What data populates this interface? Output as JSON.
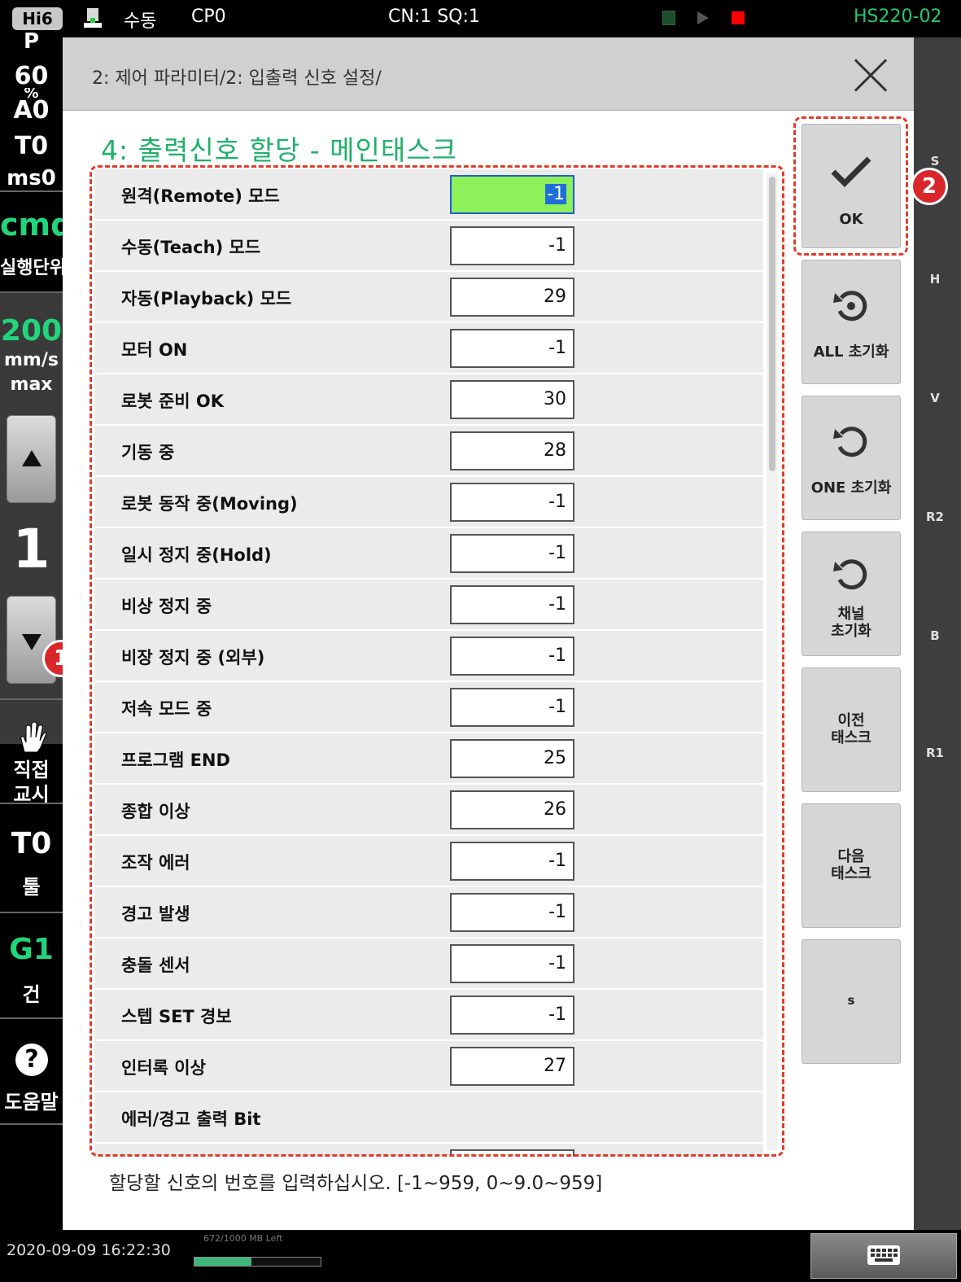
{
  "topbar": {
    "logo": "Hi6",
    "mode": "수동",
    "program": "CP0",
    "cn_sq": "CN:1 SQ:1",
    "model": "HS220-02"
  },
  "left": {
    "p": "P",
    "speed_pct": "60",
    "pct": "%",
    "a0": "A0",
    "t0": "T0",
    "ms": "ms0",
    "cmd": "cmd",
    "exec_unit": "실행단위",
    "speed": "200",
    "speed_unit": "mm/s",
    "speed_max": "max",
    "step": "1",
    "badge1": "1",
    "direct": "직접",
    "teach": "교시",
    "tool_no": "T0",
    "tool": "툴",
    "gun_no": "G1",
    "gun": "건",
    "help": "도움말",
    "help_glyph": "?"
  },
  "right_strip": [
    "S",
    "H",
    "V",
    "R2",
    "B",
    "R1"
  ],
  "dialog": {
    "breadcrumb": "2: 제어 파라미터/2: 입출력 신호 설정/",
    "title": "4: 출력신호 할당 - 메인태스크",
    "hint": "할당할 신호의 번호를 입력하십시오. [-1~959, 0~9.0~959]",
    "rows": [
      {
        "label": "원격(Remote) 모드",
        "value": "-1"
      },
      {
        "label": "수동(Teach) 모드",
        "value": "-1"
      },
      {
        "label": "자동(Playback) 모드",
        "value": "29"
      },
      {
        "label": "모터 ON",
        "value": "-1"
      },
      {
        "label": "로봇 준비 OK",
        "value": "30"
      },
      {
        "label": "기동 중",
        "value": "28"
      },
      {
        "label": "로봇 동작 중(Moving)",
        "value": "-1"
      },
      {
        "label": "일시 정지 중(Hold)",
        "value": "-1"
      },
      {
        "label": "비상 정지 중",
        "value": "-1"
      },
      {
        "label": "비장 정지 중 (외부)",
        "value": "-1"
      },
      {
        "label": "저속 모드 중",
        "value": "-1"
      },
      {
        "label": "프로그램 END",
        "value": "25"
      },
      {
        "label": "종합 이상",
        "value": "26"
      },
      {
        "label": "조작 에러",
        "value": "-1"
      },
      {
        "label": "경고 발생",
        "value": "-1"
      },
      {
        "label": "충돌 센서",
        "value": "-1"
      },
      {
        "label": "스텝 SET 경보",
        "value": "-1"
      },
      {
        "label": "인터록 이상",
        "value": "27"
      }
    ],
    "group_label": "에러/경고 출력 Bit"
  },
  "side_buttons": {
    "ok": "OK",
    "badge2": "2",
    "all_reset": "ALL 초기화",
    "one_reset": "ONE 초기화",
    "channel_reset": "채널\n초기화",
    "prev_task": "이전\n태스크",
    "next_task": "다음\n태스크",
    "s": "s"
  },
  "bottombar": {
    "datetime": "2020-09-09 16:22:30",
    "memory_label": "672/1000 MB Left",
    "memory_fill_pct": 45
  },
  "colors": {
    "accent_green": "#1fb06a",
    "selected_field": "#8ef05a",
    "annotation_red": "#e23b2b",
    "model_text": "#22c96a"
  }
}
